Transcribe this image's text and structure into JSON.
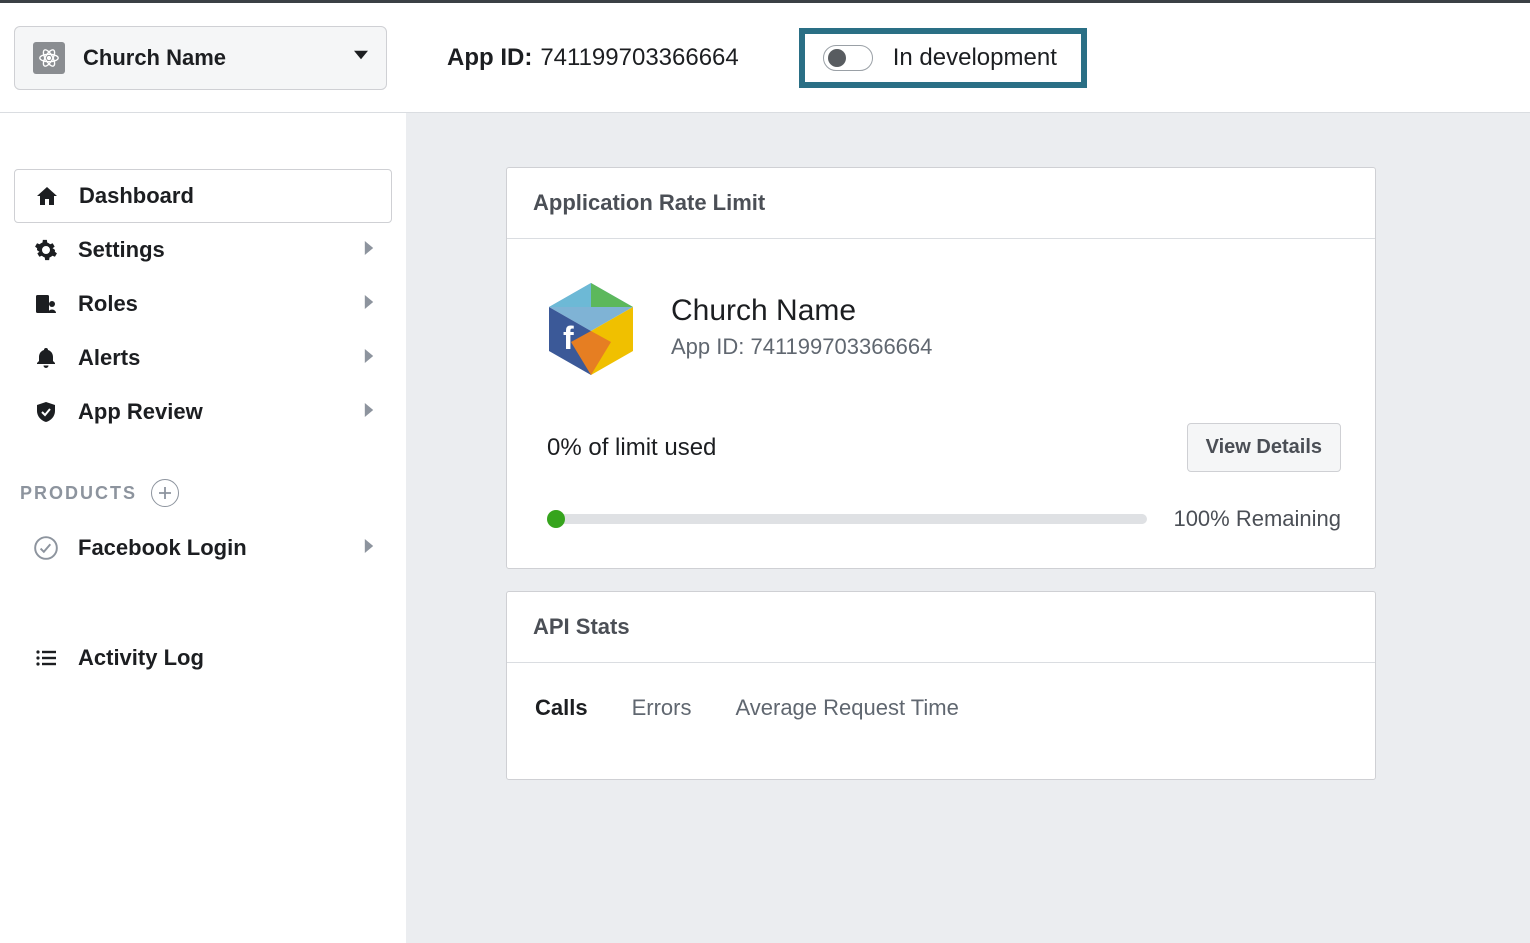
{
  "header": {
    "app_name": "Church Name",
    "app_id_label": "App ID:",
    "app_id_value": "741199703366664",
    "status_label": "In development"
  },
  "sidebar": {
    "items": [
      {
        "label": "Dashboard",
        "icon": "home",
        "expandable": false,
        "active": true
      },
      {
        "label": "Settings",
        "icon": "gear",
        "expandable": true,
        "active": false
      },
      {
        "label": "Roles",
        "icon": "roles",
        "expandable": true,
        "active": false
      },
      {
        "label": "Alerts",
        "icon": "bell",
        "expandable": true,
        "active": false
      },
      {
        "label": "App Review",
        "icon": "shield",
        "expandable": true,
        "active": false
      }
    ],
    "products_header": "PRODUCTS",
    "products": [
      {
        "label": "Facebook Login",
        "icon": "check-circle",
        "expandable": true
      }
    ],
    "activity_log": "Activity Log"
  },
  "rate_card": {
    "title": "Application Rate Limit",
    "app_name": "Church Name",
    "app_id_line": "App ID: 741199703366664",
    "limit_used": "0% of limit used",
    "view_details": "View Details",
    "remaining": "100% Remaining"
  },
  "api_stats": {
    "title": "API Stats",
    "tabs": [
      "Calls",
      "Errors",
      "Average Request Time"
    ],
    "active_tab": 0
  },
  "colors": {
    "highlight_border": "#2a6f85",
    "progress_dot": "#36a41d"
  }
}
